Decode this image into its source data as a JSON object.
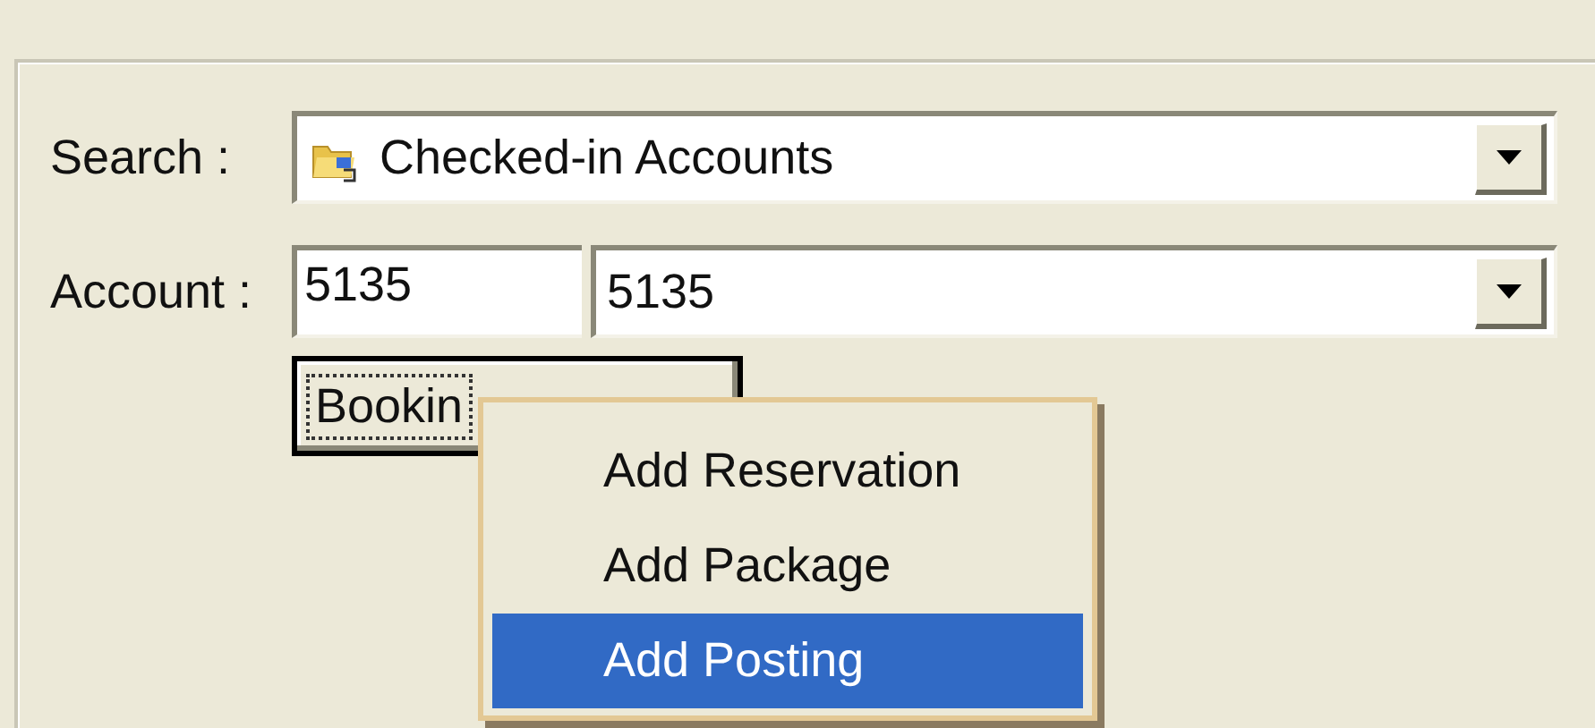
{
  "search": {
    "label": "Search :",
    "value": "Checked-in Accounts"
  },
  "account": {
    "label": "Account :",
    "code": "5135",
    "value": "5135"
  },
  "button": {
    "label": "Bookin"
  },
  "menu": {
    "items": [
      {
        "label": "Add Reservation",
        "selected": false
      },
      {
        "label": "Add Package",
        "selected": false
      },
      {
        "label": "Add Posting",
        "selected": true
      }
    ]
  }
}
